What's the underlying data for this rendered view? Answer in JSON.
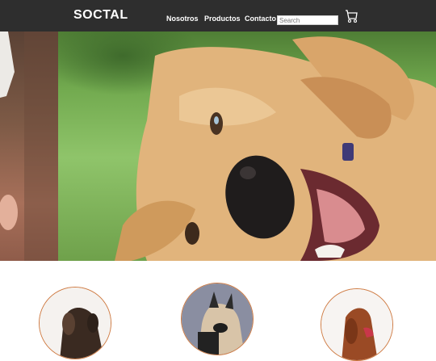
{
  "brand": "SOCTAL",
  "nav": {
    "items": [
      "Nosotros",
      "Productos",
      "Contacto"
    ]
  },
  "search": {
    "placeholder": "Search"
  },
  "icons": {
    "cart": "shopping-cart-icon"
  },
  "colors": {
    "navbar": "#2e2e2e",
    "thumb_border": "#cf7b43"
  }
}
